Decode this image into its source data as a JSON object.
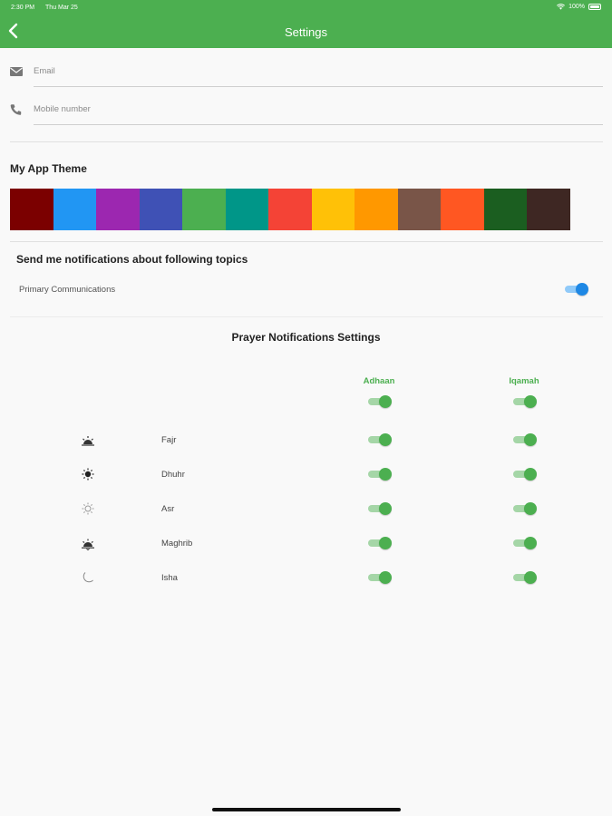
{
  "status_bar": {
    "time": "2:30 PM",
    "date": "Thu Mar 25",
    "battery": "100%"
  },
  "header": {
    "title": "Settings"
  },
  "profile": {
    "email_placeholder": "Email",
    "mobile_placeholder": "Mobile number"
  },
  "theme": {
    "title": "My App Theme",
    "colors": [
      "#7b0000",
      "#2196f3",
      "#9c27b0",
      "#3f51b5",
      "#4caf50",
      "#009688",
      "#f44336",
      "#ffc107",
      "#ff9800",
      "#795548",
      "#ff5722",
      "#1b5e20",
      "#3e2723"
    ]
  },
  "notifications": {
    "title": "Send me notifications about following topics",
    "primary_label": "Primary Communications",
    "primary_enabled": true
  },
  "prayer": {
    "title": "Prayer Notifications Settings",
    "col_adhaan": "Adhaan",
    "col_iqamah": "Iqamah",
    "all_adhaan": true,
    "all_iqamah": true,
    "rows": [
      {
        "name": "Fajr",
        "icon": "sunrise-icon",
        "adhaan": true,
        "iqamah": true
      },
      {
        "name": "Dhuhr",
        "icon": "sun-icon",
        "adhaan": true,
        "iqamah": true
      },
      {
        "name": "Asr",
        "icon": "sun-outline-icon",
        "adhaan": true,
        "iqamah": true
      },
      {
        "name": "Maghrib",
        "icon": "sunset-icon",
        "adhaan": true,
        "iqamah": true
      },
      {
        "name": "Isha",
        "icon": "moon-icon",
        "adhaan": true,
        "iqamah": true
      }
    ]
  },
  "colors": {
    "accent": "#4caf50",
    "toggle_blue": "#1e88e5"
  }
}
